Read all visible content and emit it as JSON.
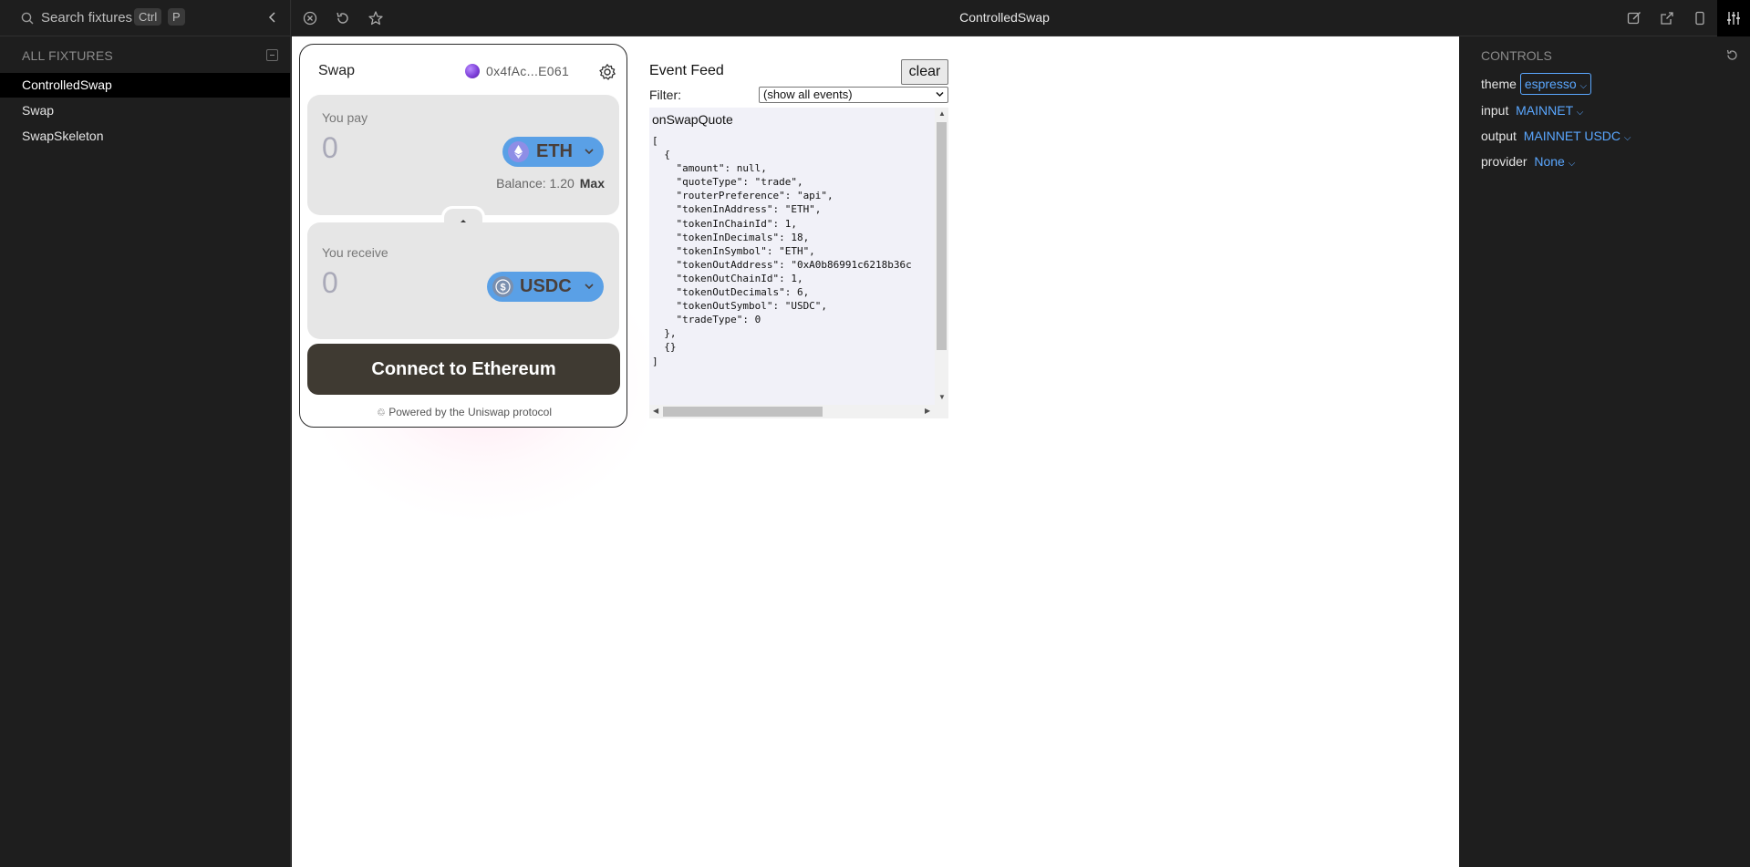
{
  "sidebar": {
    "search_placeholder": "Search fixtures",
    "shortcut_key1": "Ctrl",
    "shortcut_key2": "P",
    "section_title": "ALL FIXTURES",
    "fixtures": [
      "ControlledSwap",
      "Swap",
      "SwapSkeleton"
    ],
    "active_fixture": "ControlledSwap"
  },
  "topbar": {
    "title": "ControlledSwap"
  },
  "swap_widget": {
    "title": "Swap",
    "wallet_address": "0x4fAc...E061",
    "pay_label": "You pay",
    "pay_amount": "0",
    "pay_token": "ETH",
    "balance_text": "Balance: 1.20",
    "max_label": "Max",
    "receive_label": "You receive",
    "receive_amount": "0",
    "receive_token": "USDC",
    "connect_label": "Connect to Ethereum",
    "powered_by": "Powered by the Uniswap protocol"
  },
  "event_feed": {
    "title": "Event Feed",
    "clear_label": "clear",
    "filter_label": "Filter:",
    "filter_value": "(show all events)",
    "event_name": "onSwapQuote",
    "code": "[\n  {\n    \"amount\": null,\n    \"quoteType\": \"trade\",\n    \"routerPreference\": \"api\",\n    \"tokenInAddress\": \"ETH\",\n    \"tokenInChainId\": 1,\n    \"tokenInDecimals\": 18,\n    \"tokenInSymbol\": \"ETH\",\n    \"tokenOutAddress\": \"0xA0b86991c6218b36c\n    \"tokenOutChainId\": 1,\n    \"tokenOutDecimals\": 6,\n    \"tokenOutSymbol\": \"USDC\",\n    \"tradeType\": 0\n  },\n  {}\n]"
  },
  "controls": {
    "title": "CONTROLS",
    "rows": [
      {
        "key": "theme",
        "value": "espresso"
      },
      {
        "key": "input",
        "value": "MAINNET"
      },
      {
        "key": "output",
        "value": "MAINNET USDC"
      },
      {
        "key": "provider",
        "value": "None"
      }
    ]
  },
  "colors": {
    "accent_blue": "#5aa7ff",
    "token_button": "#5aa0e6",
    "connect_button": "#3f3a32",
    "sidebar_bg": "#1e1e1e"
  }
}
